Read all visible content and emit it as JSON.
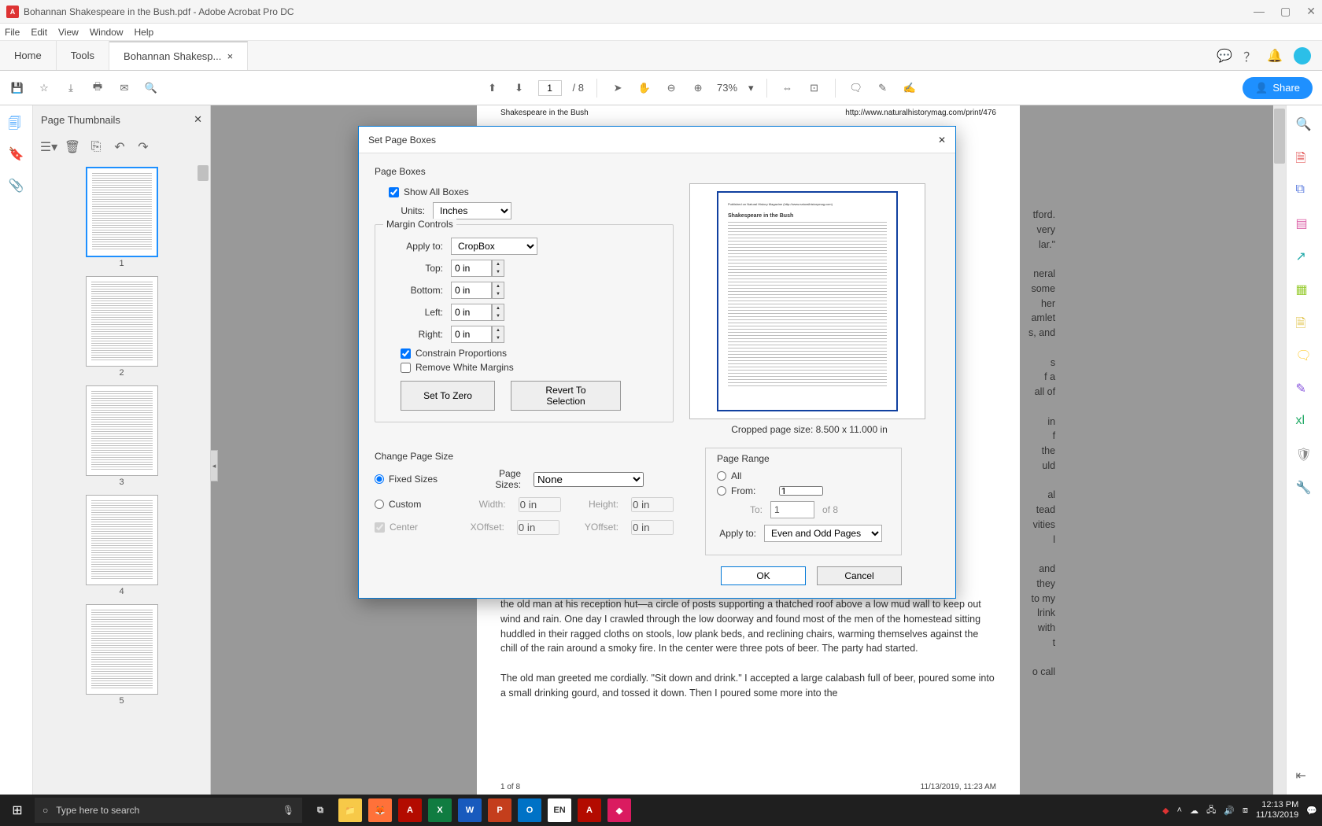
{
  "titlebar": {
    "document": "Bohannan Shakespeare in the Bush.pdf",
    "app": "Adobe Acrobat Pro DC"
  },
  "menu": [
    "File",
    "Edit",
    "View",
    "Window",
    "Help"
  ],
  "tabs": {
    "home": "Home",
    "tools": "Tools",
    "doc": "Bohannan Shakesp..."
  },
  "toolbar": {
    "page_current": "1",
    "page_total": "8",
    "zoom": "73%",
    "share": "Share"
  },
  "thumbnails": {
    "title": "Page Thumbnails",
    "pages": [
      "1",
      "2",
      "3",
      "4",
      "5"
    ]
  },
  "document": {
    "header_left": "Shakespeare in the Bush",
    "header_right": "http://www.naturalhistorymag.com/print/476",
    "body_text": "the old man at his reception hut—a circle of posts supporting a thatched roof above a low mud wall to keep out wind and rain. One day I crawled through the low doorway and found most of the men of the homestead sitting huddled in their ragged cloths on stools, low plank beds, and reclining chairs, warming themselves against the chill of the rain around a smoky fire. In the center were three pots of beer. The party had started.\n\nThe old man greeted me cordially. \"Sit down and drink.\" I accepted a large calabash full of beer, poured some into a small drinking gourd, and tossed it down. Then I poured some more into the",
    "side_frag": "tford.\nvery\nlar.\"\n\nneral\nsome\nher\namlet\ns, and\n\ns\nf a\nall of\n\n in\nf\n the\nuld\n\nal\ntead\nvities\nl\n\n and\n they\nto my\nlrink\nwith\nt\n\no call",
    "footer_page": "1 of 8",
    "footer_right": "11/13/2019, 11:23 AM"
  },
  "dialog": {
    "title": "Set Page Boxes",
    "page_boxes_label": "Page Boxes",
    "show_all": "Show All Boxes",
    "units_label": "Units:",
    "units_value": "Inches",
    "margin_controls": "Margin Controls",
    "apply_to_label": "Apply to:",
    "apply_to_value": "CropBox",
    "top": "Top:",
    "bottom": "Bottom:",
    "left": "Left:",
    "right": "Right:",
    "zero": "0 in",
    "constrain": "Constrain Proportions",
    "remove_white": "Remove White Margins",
    "set_zero": "Set To Zero",
    "revert": "Revert To Selection",
    "preview_caption_a": "Cropped page size: ",
    "preview_caption_b": "8.500 x 11.000 in",
    "preview_pub": "Published on Natural History Magazine (http://www.naturalhistorymag.com)",
    "preview_title": "Shakespeare in the Bush",
    "change_page_size": "Change Page Size",
    "fixed_sizes": "Fixed Sizes",
    "custom": "Custom",
    "center": "Center",
    "page_sizes_label": "Page Sizes:",
    "page_sizes_value": "None",
    "width_label": "Width:",
    "height_label": "Height:",
    "xoffset_label": "XOffset:",
    "yoffset_label": "YOffset:",
    "page_range_label": "Page Range",
    "all": "All",
    "from": "From:",
    "to": "To:",
    "from_value": "1",
    "to_value": "1",
    "of_pages": "of 8",
    "range_apply_label": "Apply to:",
    "range_apply_value": "Even and Odd Pages",
    "ok": "OK",
    "cancel": "Cancel"
  },
  "taskbar": {
    "search_placeholder": "Type here to search",
    "time": "12:13 PM",
    "date": "11/13/2019",
    "lang": "EN"
  }
}
